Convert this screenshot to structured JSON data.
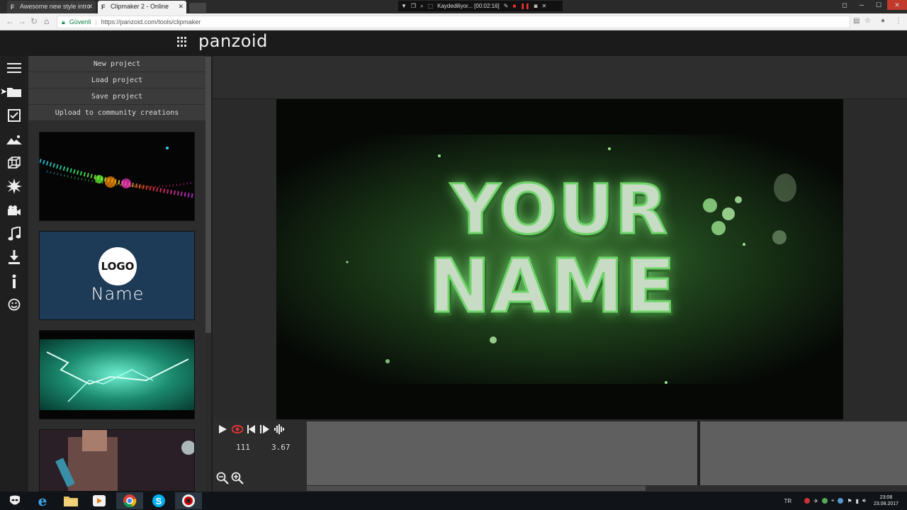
{
  "browser": {
    "tabs": [
      {
        "label": "Awesome new style intro",
        "favicon": "F"
      },
      {
        "label": "Clipmaker 2 - Online",
        "favicon": "F"
      }
    ],
    "recorder": {
      "status": "Kaydediliyor... [00:02:16]"
    },
    "address": {
      "secure_label": "Güvenli",
      "url": "https://panzoid.com/tools/clipmaker"
    }
  },
  "app": {
    "logo": "panzoid",
    "rail_icons": [
      "menu-icon",
      "folder-icon",
      "checkbox-icon",
      "image-icon",
      "cube-icon",
      "burst-icon",
      "camera-icon",
      "music-icon",
      "download-icon",
      "info-icon",
      "smiley-icon"
    ],
    "menu": [
      "New project",
      "Load project",
      "Save project",
      "Upload to community creations"
    ],
    "thumbnails": [
      {
        "name": "thumb-rainbow-particles"
      },
      {
        "name": "thumb-logo-name",
        "logo_text": "LOGO",
        "name_text": "Name",
        "bg": "#1d3550"
      },
      {
        "name": "thumb-green-lightning"
      },
      {
        "name": "thumb-minecraft"
      }
    ],
    "preview": {
      "line1": "YOUR",
      "line2": "NAME",
      "accent": "#6fd36a"
    },
    "timeline": {
      "frame": "111",
      "time": "3.67"
    }
  },
  "taskbar": {
    "lang": "TR",
    "time": "23:08",
    "date": "23.08.2017"
  }
}
